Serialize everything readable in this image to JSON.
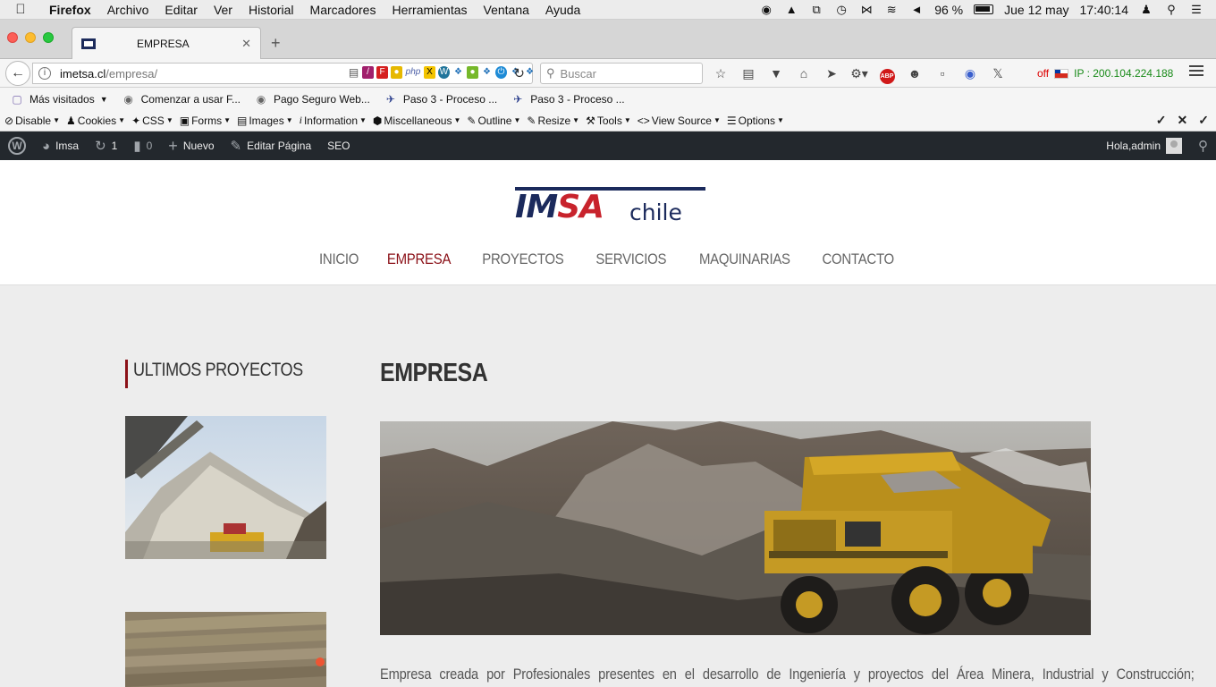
{
  "menubar": {
    "app": "Firefox",
    "items": [
      "Archivo",
      "Editar",
      "Ver",
      "Historial",
      "Marcadores",
      "Herramientas",
      "Ventana",
      "Ayuda"
    ],
    "battery": "96 %",
    "date": "Jue 12 may",
    "time": "17:40:14"
  },
  "tab": {
    "title": "EMPRESA"
  },
  "urlbar": {
    "host": "imetsa.cl",
    "path": "/empresa/"
  },
  "search": {
    "placeholder": "Buscar"
  },
  "proxy": {
    "status": "off",
    "ip": "IP : 200.104.224.188"
  },
  "bookmarks": [
    "Más visitados",
    "Comenzar a usar F...",
    "Pago Seguro Web...",
    "Paso 3 - Proceso ...",
    "Paso 3 - Proceso ..."
  ],
  "devtools": [
    "Disable",
    "Cookies",
    "CSS",
    "Forms",
    "Images",
    "Information",
    "Miscellaneous",
    "Outline",
    "Resize",
    "Tools",
    "View Source",
    "Options"
  ],
  "wpbar": {
    "site": "Imsa",
    "updates": "1",
    "comments": "0",
    "new": "Nuevo",
    "edit": "Editar Página",
    "seo": "SEO",
    "greeting": "Hola,admin"
  },
  "logo": {
    "brand_im": "IM",
    "brand_sa": "SA",
    "suffix": "chile"
  },
  "nav": [
    "INICIO",
    "EMPRESA",
    "PROYECTOS",
    "SERVICIOS",
    "MAQUINARIAS",
    "CONTACTO"
  ],
  "sidebar": {
    "title": "ULTIMOS PROYECTOS"
  },
  "page": {
    "title": "EMPRESA",
    "intro": "Empresa creada por Profesionales presentes en el desarrollo de Ingeniería y proyectos del Área Minera, Industrial y Construcción;"
  },
  "colors": {
    "accent": "#8b1118",
    "brand_navy": "#1b2a5c",
    "brand_red": "#c8232c",
    "wpbar": "#23282d"
  }
}
